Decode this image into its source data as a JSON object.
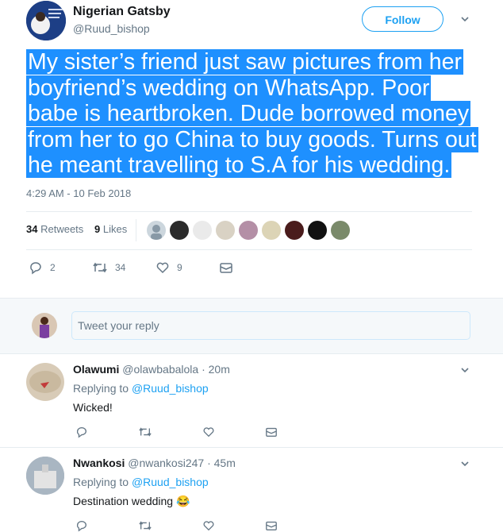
{
  "author": {
    "name": "Nigerian Gatsby",
    "handle": "@Ruud_bishop",
    "follow_label": "Follow"
  },
  "tweet": {
    "lines": [
      "My sister’s friend just saw pictures from her",
      "boyfriend’s wedding on WhatsApp. Poor",
      "babe is heartbroken. Dude borrowed money",
      "from her to go China to buy goods. Turns out",
      "he meant travelling to S.A for his wedding."
    ],
    "timestamp": "4:29 AM - 10 Feb 2018",
    "retweets_count": "34",
    "retweets_label": "Retweets",
    "likes_count": "9",
    "likes_label": "Likes",
    "actions": {
      "reply_count": "2",
      "retweet_count": "34",
      "like_count": "9"
    }
  },
  "reply_composer": {
    "placeholder": "Tweet your reply"
  },
  "replies": [
    {
      "name": "Olawumi",
      "handle": "@olawbabalola",
      "time": "· 20m",
      "replying_prefix": "Replying to",
      "replying_to": "@Ruud_bishop",
      "text": "Wicked!"
    },
    {
      "name": "Nwankosi",
      "handle": "@nwankosi247",
      "time": "· 45m",
      "replying_prefix": "Replying to",
      "replying_to": "@Ruud_bishop",
      "text": "Destination wedding",
      "emoji": "😂"
    }
  ],
  "colors": {
    "accent": "#1da1f2",
    "highlight": "#1e90ff",
    "muted": "#657786"
  }
}
